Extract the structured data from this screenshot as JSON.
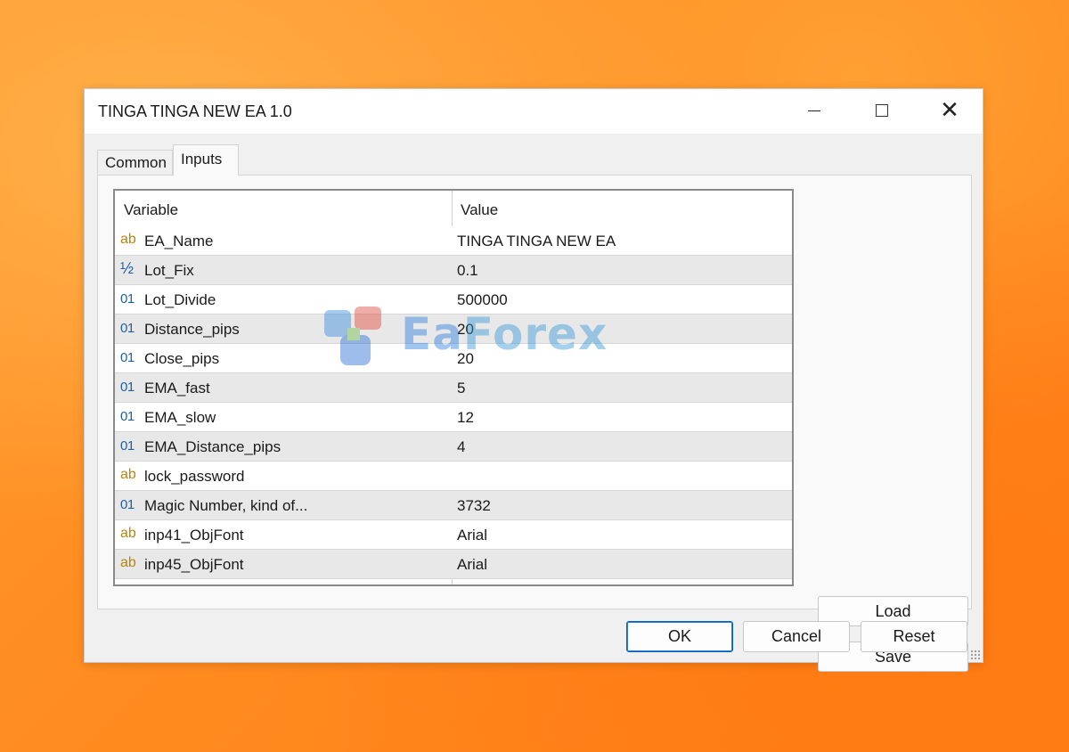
{
  "window": {
    "title": "TINGA TINGA NEW EA 1.0",
    "minimize_icon": "minimize-icon",
    "maximize_icon": "maximize-icon",
    "close_icon": "close-icon",
    "close_glyph": "✕"
  },
  "tabs": [
    {
      "label": "Common",
      "active": false
    },
    {
      "label": "Inputs",
      "active": true
    }
  ],
  "grid": {
    "headers": {
      "variable": "Variable",
      "value": "Value"
    },
    "rows": [
      {
        "type": "ab",
        "name": "EA_Name",
        "value": "TINGA TINGA NEW EA"
      },
      {
        "type": "½",
        "name": "Lot_Fix",
        "value": "0.1"
      },
      {
        "type": "01",
        "name": "Lot_Divide",
        "value": "500000"
      },
      {
        "type": "01",
        "name": "Distance_pips",
        "value": "20"
      },
      {
        "type": "01",
        "name": "Close_pips",
        "value": "20"
      },
      {
        "type": "01",
        "name": "EMA_fast",
        "value": "5"
      },
      {
        "type": "01",
        "name": "EMA_slow",
        "value": "12"
      },
      {
        "type": "01",
        "name": "EMA_Distance_pips",
        "value": "4"
      },
      {
        "type": "ab",
        "name": "lock_password",
        "value": ""
      },
      {
        "type": "01",
        "name": "Magic Number, kind of...",
        "value": "3732"
      },
      {
        "type": "ab",
        "name": "inp41_ObjFont",
        "value": "Arial"
      },
      {
        "type": "ab",
        "name": "inp45_ObjFont",
        "value": "Arial"
      }
    ]
  },
  "watermark": {
    "text": "EaForex"
  },
  "side_buttons": {
    "load": "Load",
    "save": "Save"
  },
  "footer_buttons": {
    "ok": "OK",
    "cancel": "Cancel",
    "reset": "Reset"
  },
  "colors": {
    "accent": "#005fb8",
    "string_type": "#b8860b",
    "numeric_type": "#1f5fa8",
    "background": "#ff8a1e"
  }
}
